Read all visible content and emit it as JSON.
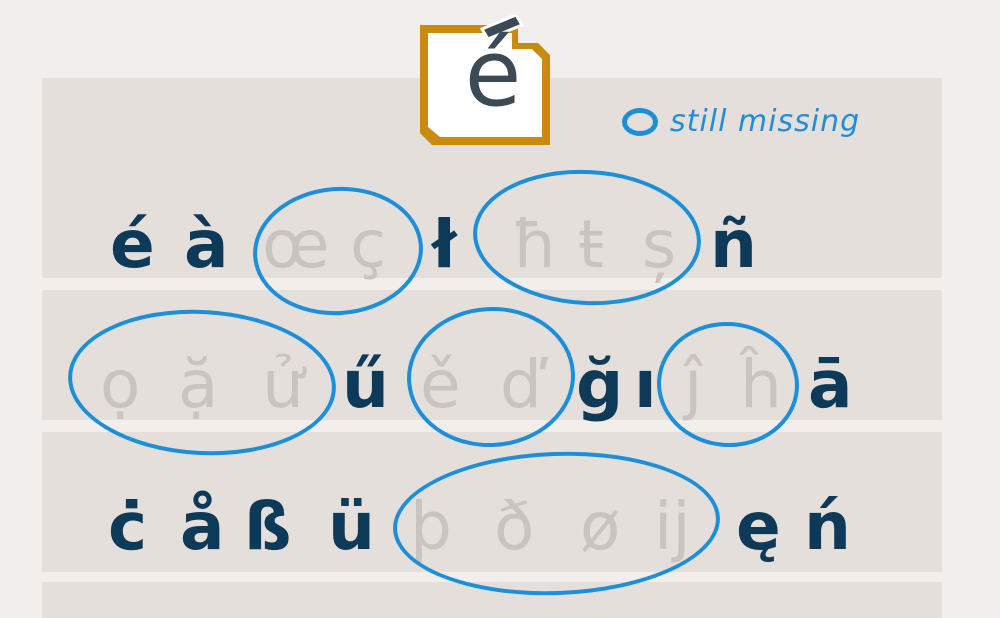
{
  "logo": {
    "glyph": "é",
    "icon": "e-acute-logo-icon",
    "frame_color": "#c98a10",
    "glyph_color": "#3b4a54"
  },
  "legend": {
    "text": "still missing",
    "ring_color": "#1c8fd8"
  },
  "colors": {
    "present": "#0e3a59",
    "missing": "#c9c4c0",
    "ring": "#1c8fd8",
    "background": "#f1eeec",
    "strip": "#e4dfdb"
  },
  "rows": [
    {
      "glyphs": [
        {
          "char": "é",
          "missing": false
        },
        {
          "char": "à",
          "missing": false
        },
        {
          "char": "œ",
          "missing": true
        },
        {
          "char": "ç",
          "missing": true
        },
        {
          "char": "ł",
          "missing": false
        },
        {
          "char": "ħ",
          "missing": true
        },
        {
          "char": "ŧ",
          "missing": true
        },
        {
          "char": "ș",
          "missing": true
        },
        {
          "char": "ñ",
          "missing": false
        }
      ]
    },
    {
      "glyphs": [
        {
          "char": "ọ",
          "missing": true
        },
        {
          "char": "ặ",
          "missing": true
        },
        {
          "char": "ử",
          "missing": true
        },
        {
          "char": "ű",
          "missing": false
        },
        {
          "char": "ě",
          "missing": true
        },
        {
          "char": "ď",
          "missing": true
        },
        {
          "char": "ğ",
          "missing": false
        },
        {
          "char": "ı",
          "missing": false
        },
        {
          "char": "ĵ",
          "missing": true
        },
        {
          "char": "ĥ",
          "missing": true
        },
        {
          "char": "ā",
          "missing": false
        }
      ]
    },
    {
      "glyphs": [
        {
          "char": "ċ",
          "missing": false
        },
        {
          "char": "å",
          "missing": false
        },
        {
          "char": "ß",
          "missing": false
        },
        {
          "char": "ü",
          "missing": false
        },
        {
          "char": "þ",
          "missing": true
        },
        {
          "char": "ð",
          "missing": true
        },
        {
          "char": "ø",
          "missing": true
        },
        {
          "char": "ĳ",
          "missing": true
        },
        {
          "char": "ę",
          "missing": false
        },
        {
          "char": "ń",
          "missing": false
        }
      ]
    }
  ]
}
